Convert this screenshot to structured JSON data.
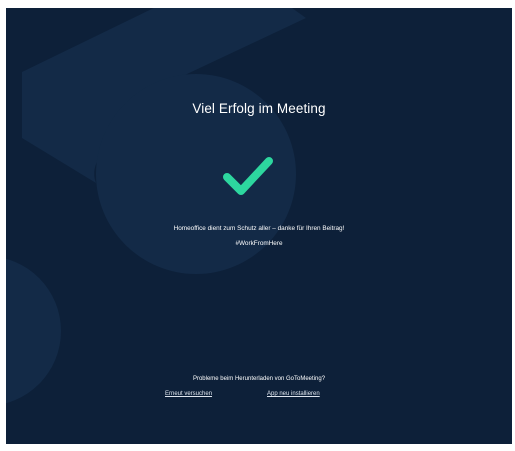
{
  "page": {
    "background_color": "#0d2039",
    "accent_color": "#2dd79f",
    "title": "Viel Erfolg im Meeting",
    "success_icon": "checkmark-icon",
    "message": "Homeoffice dient zum Schutz aller – danke für Ihren Beitrag!",
    "hashtag": "#WorkFromHere"
  },
  "footer": {
    "problem_text": "Probleme beim Herunterladen von GoToMeeting?",
    "retry_link": "Erneut versuchen",
    "reinstall_link": "App neu installieren"
  }
}
